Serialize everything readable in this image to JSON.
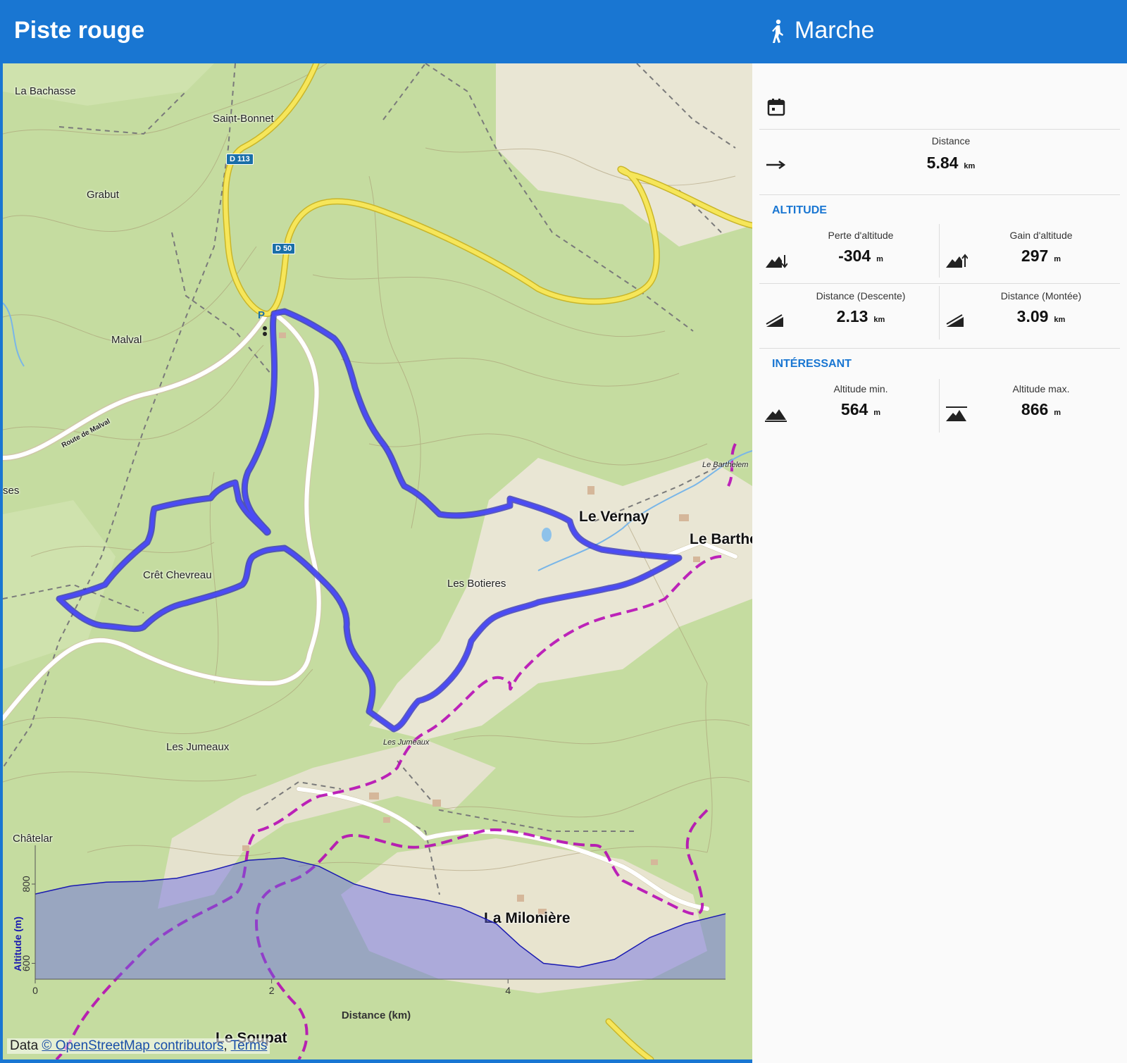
{
  "header": {
    "title": "Piste rouge",
    "activity": "Marche",
    "activity_icon": "walking-icon"
  },
  "map": {
    "places": {
      "la_bachasse": "La Bachasse",
      "saint_bonnet": "Saint-Bonnet",
      "grabut": "Grabut",
      "malval": "Malval",
      "ses": "ses",
      "cret_chevreau": "Crêt Chevreau",
      "le_vernay": "Le Vernay",
      "le_barthe": "Le Barthe",
      "le_barthelem": "Le Barthelem",
      "les_botieres": "Les Botieres",
      "les_jumeaux": "Les Jumeaux",
      "les_jumeaux_small": "Les Jumeaux",
      "chatelar": "Châtelar",
      "la_miloniere": "La Milonière",
      "le_soupat": "Le Soupat",
      "route_de_malval": "Route de Malval"
    },
    "road_badges": {
      "d113": "D 113",
      "d50": "D 50"
    },
    "parking": "P",
    "attribution": {
      "prefix": "Data ",
      "osm": "© OpenStreetMap contributors",
      "sep": ", ",
      "terms": "Terms"
    }
  },
  "chart_data": {
    "type": "area",
    "xlabel": "Distance (km)",
    "ylabel": "Altitude (m)",
    "x_ticks": [
      "0",
      "2",
      "4"
    ],
    "y_ticks": [
      "600",
      "800"
    ],
    "xlim": [
      0,
      5.84
    ],
    "ylim": [
      564,
      866
    ],
    "x": [
      0,
      0.3,
      0.6,
      0.9,
      1.2,
      1.5,
      1.8,
      2.1,
      2.4,
      2.7,
      3.0,
      3.3,
      3.6,
      3.9,
      4.1,
      4.3,
      4.6,
      4.9,
      5.2,
      5.5,
      5.84
    ],
    "y": [
      775,
      795,
      805,
      807,
      815,
      835,
      860,
      866,
      845,
      800,
      775,
      760,
      740,
      700,
      645,
      600,
      590,
      610,
      665,
      700,
      725
    ]
  },
  "stats": {
    "distance": {
      "label": "Distance",
      "value": "5.84",
      "unit": "km"
    },
    "altitude_section": "ALTITUDE",
    "elevation_loss": {
      "label": "Perte d'altitude",
      "value": "-304",
      "unit": "m"
    },
    "elevation_gain": {
      "label": "Gain d'altitude",
      "value": "297",
      "unit": "m"
    },
    "distance_descent": {
      "label": "Distance (Descente)",
      "value": "2.13",
      "unit": "km"
    },
    "distance_ascent": {
      "label": "Distance (Montée)",
      "value": "3.09",
      "unit": "km"
    },
    "interesting_section": "INTÉRESSANT",
    "altitude_min": {
      "label": "Altitude min.",
      "value": "564",
      "unit": "m"
    },
    "altitude_max": {
      "label": "Altitude max.",
      "value": "866",
      "unit": "m"
    }
  },
  "colors": {
    "header": "#1976d2",
    "route": "#3c3cf0",
    "yellow_road": "#f2e14a",
    "boundary": "#b400b4",
    "section": "#1976d2"
  }
}
